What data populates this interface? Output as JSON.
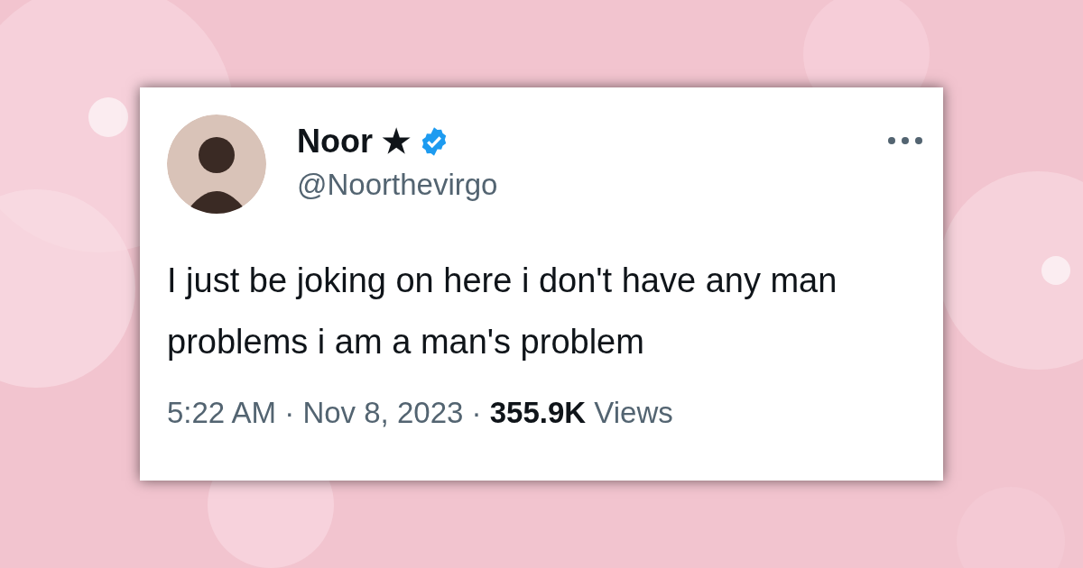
{
  "tweet": {
    "author": {
      "name": "Noor ★",
      "handle": "@Noorthevirgo",
      "verified": true
    },
    "text": "I just be joking on here i don't have any man problems i am a man's problem",
    "footer": "5:22 AM · Nov 8, 2023 · **355.9K** Views"
  }
}
